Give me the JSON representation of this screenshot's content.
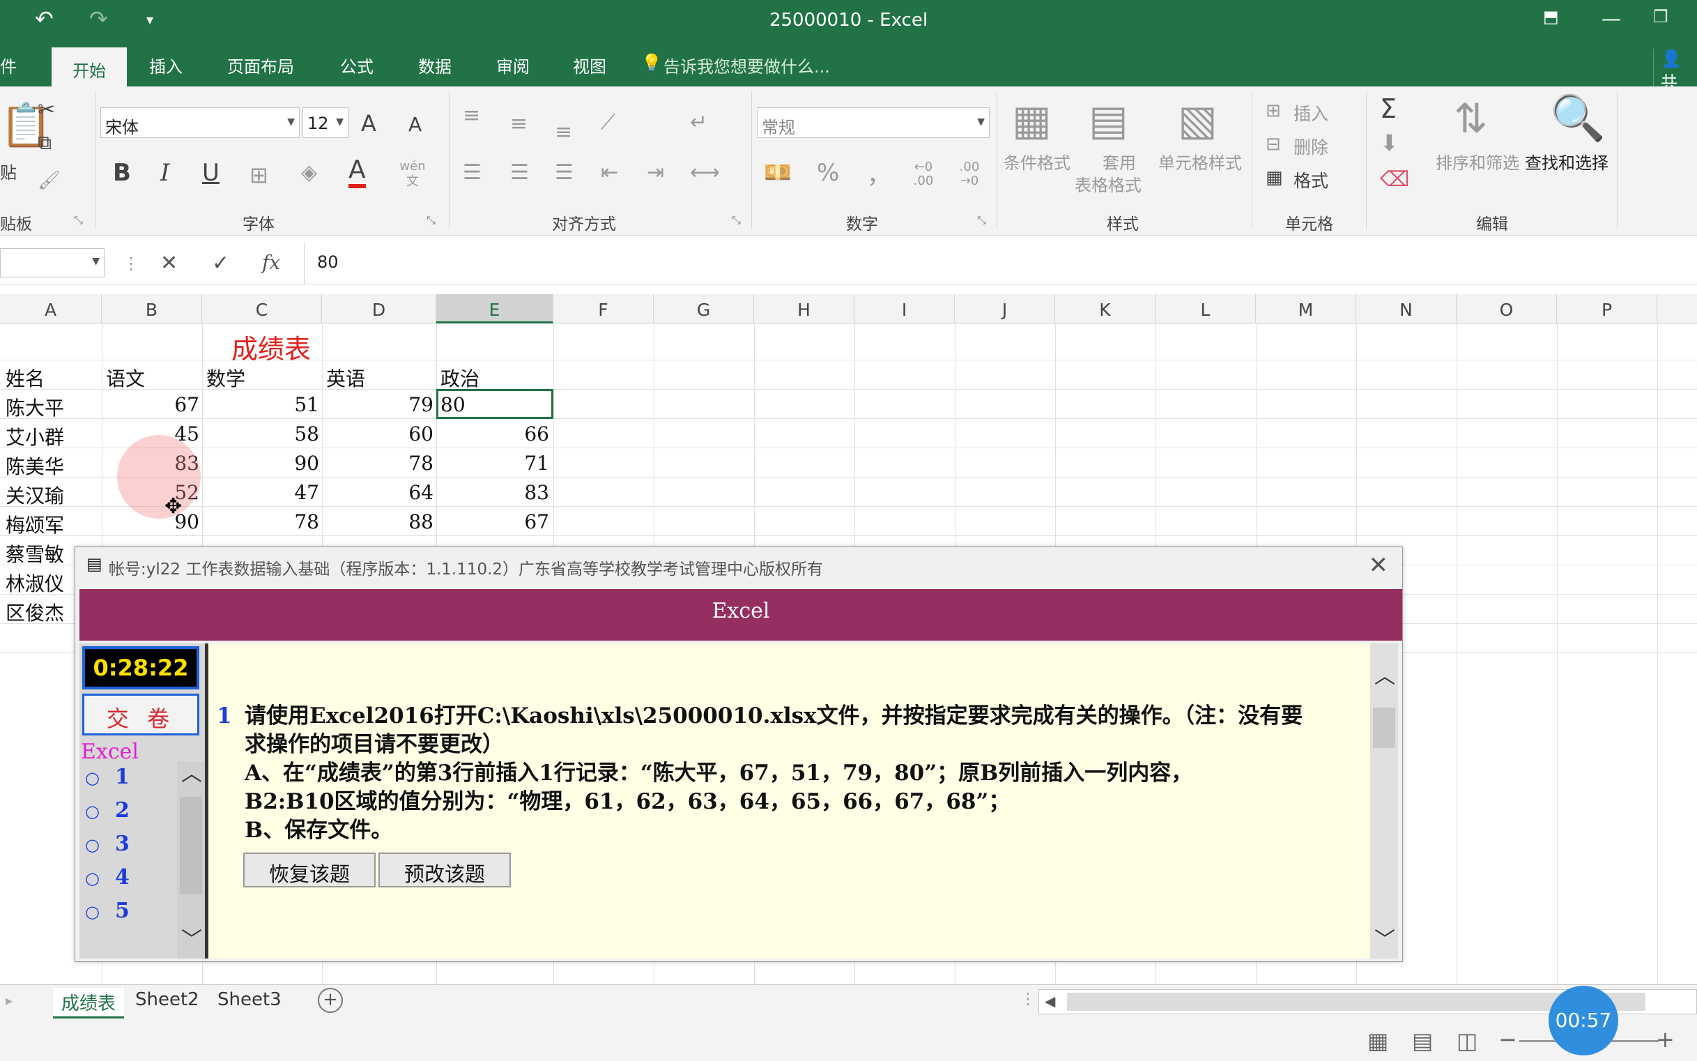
{
  "titlebar": {
    "title": "25000010 - Excel",
    "undo_icon": "↶",
    "redo_icon": "↷",
    "customize_icon": "▾"
  },
  "tabs": [
    {
      "label": "件"
    },
    {
      "label": "开始"
    },
    {
      "label": "插入"
    },
    {
      "label": "页面布局"
    },
    {
      "label": "公式"
    },
    {
      "label": "数据"
    },
    {
      "label": "审阅"
    },
    {
      "label": "视图"
    }
  ],
  "tellme": "告诉我您想要做什么...",
  "share": "共",
  "ribbon": {
    "clipboard": {
      "label": "贴板",
      "paste": "贴"
    },
    "font": {
      "label": "字体",
      "family": "宋体",
      "size": "12",
      "bold": "B",
      "italic": "I",
      "underline": "U",
      "grow": "A",
      "shrink": "A",
      "color": "A",
      "phonetic": "wén 文"
    },
    "alignment": {
      "label": "对齐方式"
    },
    "number": {
      "label": "数字",
      "format": "常规",
      "percent": "%",
      "comma": "，",
      "inc_decimal": "←0 .00",
      "dec_decimal": ".00 →0"
    },
    "styles": {
      "label": "样式",
      "conditional": "条件格式",
      "table_format_1": "套用",
      "table_format_2": "表格格式",
      "cell_styles": "单元格样式"
    },
    "cells": {
      "label": "单元格",
      "insert": "插入",
      "delete": "删除",
      "format": "格式"
    },
    "editing": {
      "label": "编辑",
      "sum": "Σ",
      "sort_filter": "排序和筛选",
      "find_select": "查找和选择"
    }
  },
  "formula_bar": {
    "cancel": "✕",
    "enter": "✓",
    "fx": "fx",
    "value": "80"
  },
  "columns": [
    "A",
    "B",
    "C",
    "D",
    "E",
    "F",
    "G",
    "H",
    "I",
    "J",
    "K",
    "L",
    "M",
    "N",
    "O",
    "P"
  ],
  "sheet": {
    "title": "成绩表",
    "headers": [
      "姓名",
      "语文",
      "数学",
      "英语",
      "政治"
    ],
    "rows": [
      {
        "name": "陈大平",
        "v": [
          "67",
          "51",
          "79",
          "80"
        ]
      },
      {
        "name": "艾小群",
        "v": [
          "45",
          "58",
          "60",
          "66"
        ]
      },
      {
        "name": "陈美华",
        "v": [
          "83",
          "90",
          "78",
          "71"
        ]
      },
      {
        "name": "关汉瑜",
        "v": [
          "52",
          "47",
          "64",
          "83"
        ]
      },
      {
        "name": "梅颂军",
        "v": [
          "90",
          "78",
          "88",
          "67"
        ]
      },
      {
        "name": "蔡雪敏"
      },
      {
        "name": "林淑仪"
      },
      {
        "name": "区俊杰"
      }
    ]
  },
  "sheet_tabs": [
    "成绩表",
    "Sheet2",
    "Sheet3"
  ],
  "timer_badge": "00:57",
  "dialog": {
    "title": "帐号:yl22  工作表数据输入基础（程序版本：1.1.110.2）广东省高等学校教学考试管理中心版权所有",
    "banner": "Excel",
    "clock": "0:28:22",
    "submit": "交 卷",
    "nav_title": "Excel",
    "nav_items": [
      "1",
      "2",
      "3",
      "4",
      "5"
    ],
    "question_number": "1",
    "question_lines": [
      "请使用Excel2016打开C:\\Kaoshi\\xls\\25000010.xlsx文件，并按指定要求完成有关的操作。（注：没有要",
      "求操作的项目请不要更改）",
      "A、在“成绩表”的第3行前插入1行记录：“陈大平，67，51，79，80”；原B列前插入一列内容，",
      "B2:B10区域的值分别为：“物理，61，62，63，64，65，66，67，68”；",
      "B、保存文件。"
    ],
    "restore_button": "恢复该题",
    "preview_button": "预改该题"
  }
}
